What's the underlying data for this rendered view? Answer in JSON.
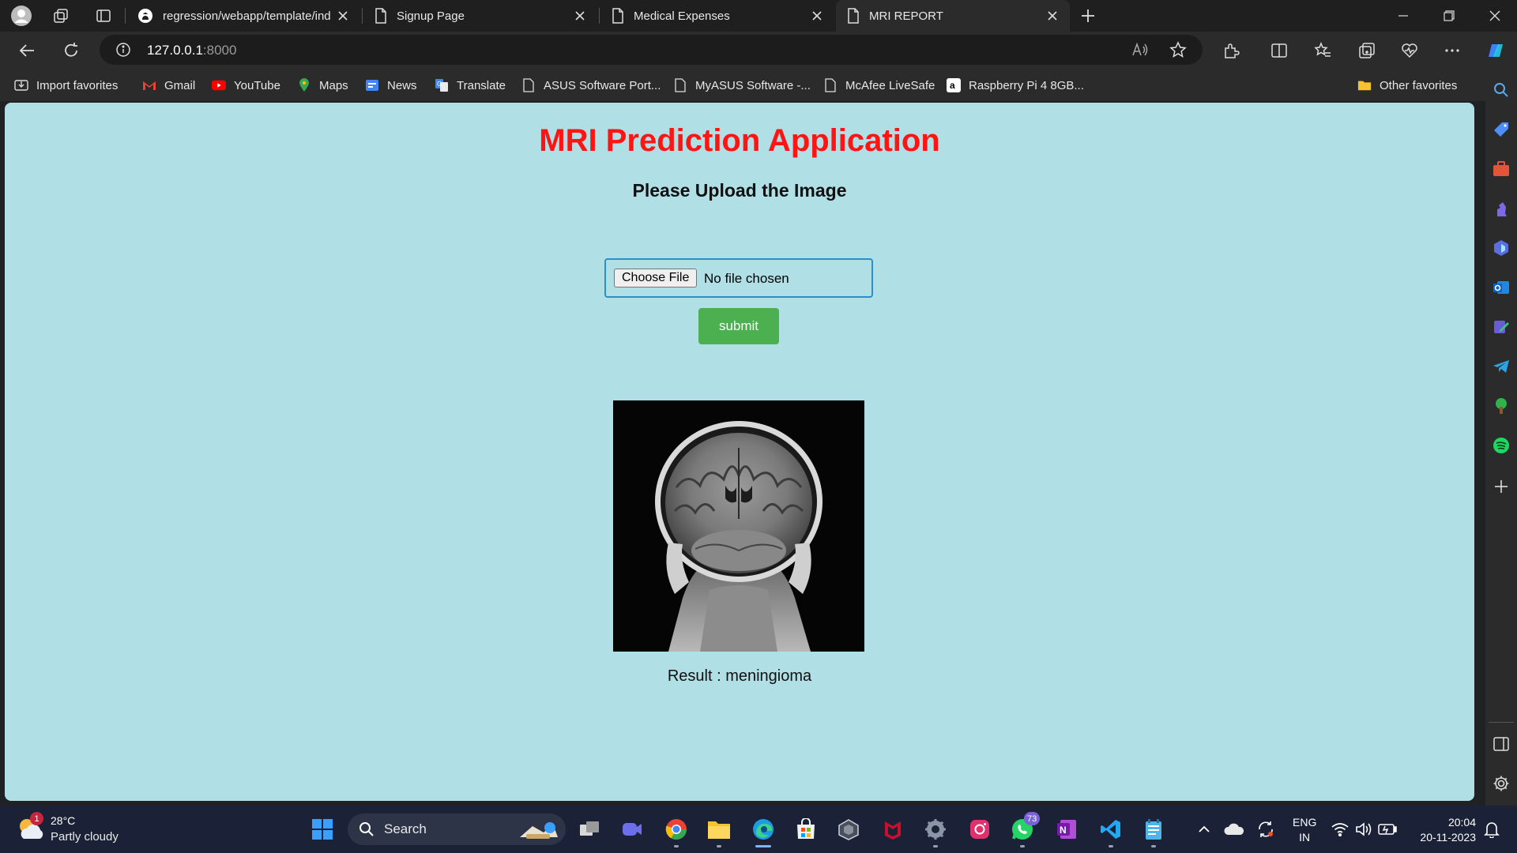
{
  "browser": {
    "tabs": [
      {
        "title": "regression/webapp/template/ind",
        "icon": "github-icon"
      },
      {
        "title": "Signup Page",
        "icon": "page-icon"
      },
      {
        "title": "Medical Expenses",
        "icon": "page-icon"
      },
      {
        "title": "MRI REPORT",
        "icon": "page-icon",
        "active": true
      }
    ],
    "address": {
      "host": "127.0.0.1",
      "port": ":8000"
    },
    "favorites": [
      {
        "label": "Import favorites",
        "icon": "import-icon"
      },
      {
        "label": "Gmail",
        "icon": "gmail-icon"
      },
      {
        "label": "YouTube",
        "icon": "youtube-icon"
      },
      {
        "label": "Maps",
        "icon": "maps-icon"
      },
      {
        "label": "News",
        "icon": "news-icon"
      },
      {
        "label": "Translate",
        "icon": "translate-icon"
      },
      {
        "label": "ASUS Software Port...",
        "icon": "page-icon"
      },
      {
        "label": "MyASUS Software -...",
        "icon": "page-icon"
      },
      {
        "label": "McAfee LiveSafe",
        "icon": "page-icon"
      },
      {
        "label": "Raspberry Pi 4 8GB...",
        "icon": "amazon-icon"
      },
      {
        "label": "Other favorites",
        "icon": "folder-icon"
      }
    ]
  },
  "page": {
    "title": "MRI Prediction Application",
    "subtitle": "Please Upload the Image",
    "file_input": {
      "button_label": "Choose File",
      "status": "No file chosen"
    },
    "submit_label": "submit",
    "result_text": "Result : meningioma"
  },
  "taskbar": {
    "weather": {
      "temp": "28°C",
      "desc": "Partly cloudy",
      "badge": "1"
    },
    "search_label": "Search",
    "whatsapp_badge": "73",
    "lang": {
      "line1": "ENG",
      "line2": "IN"
    },
    "clock": {
      "time": "20:04",
      "date": "20-11-2023"
    }
  },
  "colors": {
    "page_bg": "#b0dfe5",
    "title_red": "#ff1414",
    "submit_green": "#4caf50",
    "file_border": "#2c8fc7"
  }
}
